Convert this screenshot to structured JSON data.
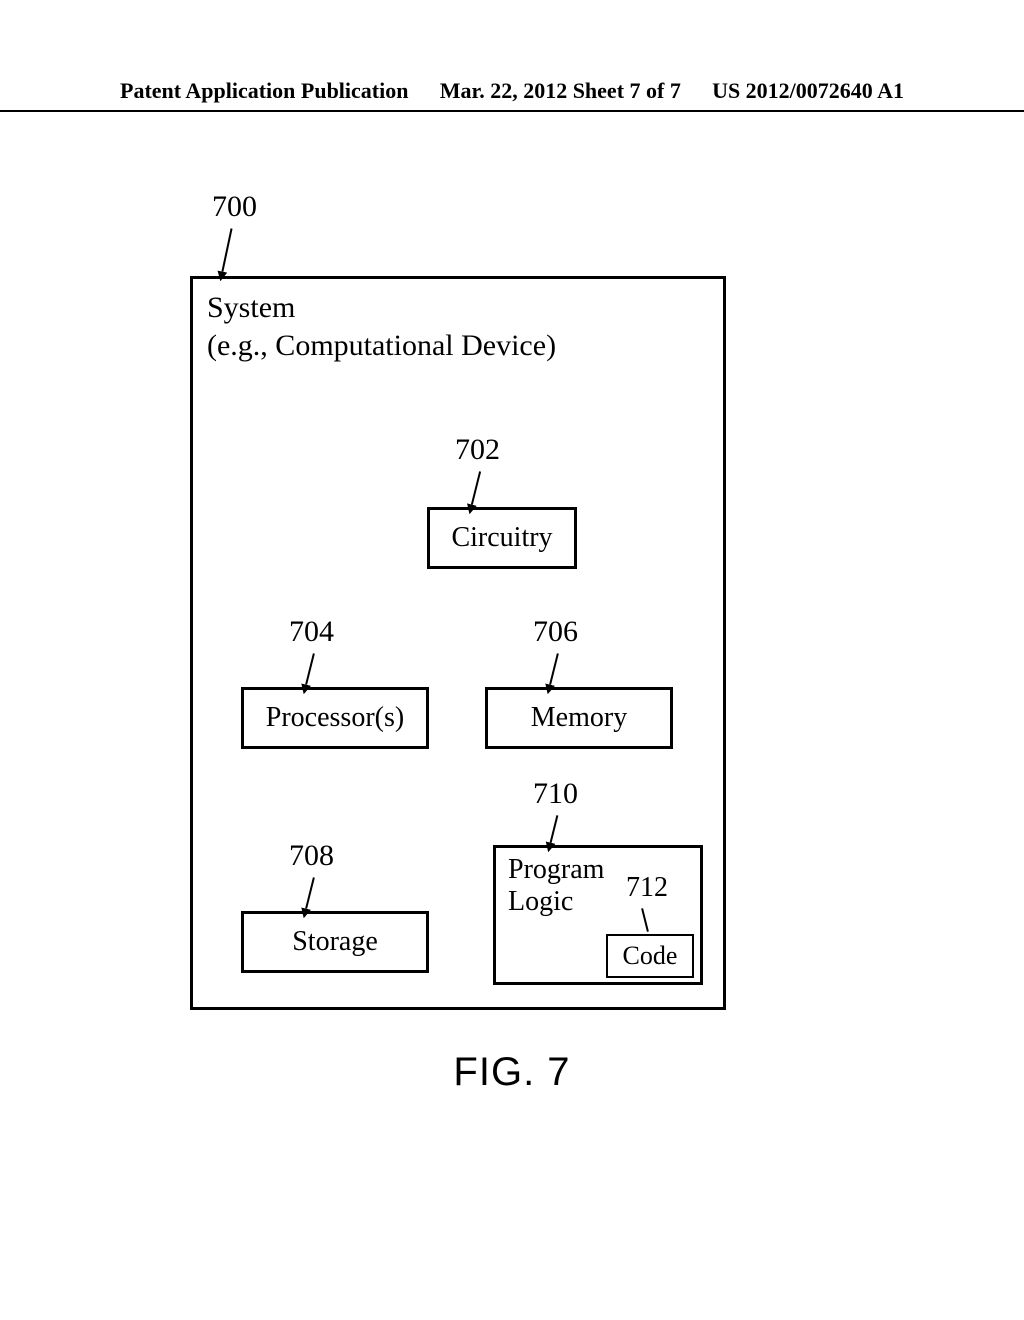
{
  "header": {
    "left": "Patent Application Publication",
    "center": "Mar. 22, 2012  Sheet 7 of 7",
    "right": "US 2012/0072640 A1"
  },
  "labels": {
    "r700": "700",
    "r702": "702",
    "r704": "704",
    "r706": "706",
    "r708": "708",
    "r710": "710",
    "r712": "712"
  },
  "system": {
    "line1": "System",
    "line2": "(e.g., Computational Device)"
  },
  "blocks": {
    "circuitry": "Circuitry",
    "processors": "Processor(s)",
    "memory": "Memory",
    "storage": "Storage",
    "program1": "Program",
    "program2": "Logic",
    "code": "Code"
  },
  "caption": "FIG. 7"
}
